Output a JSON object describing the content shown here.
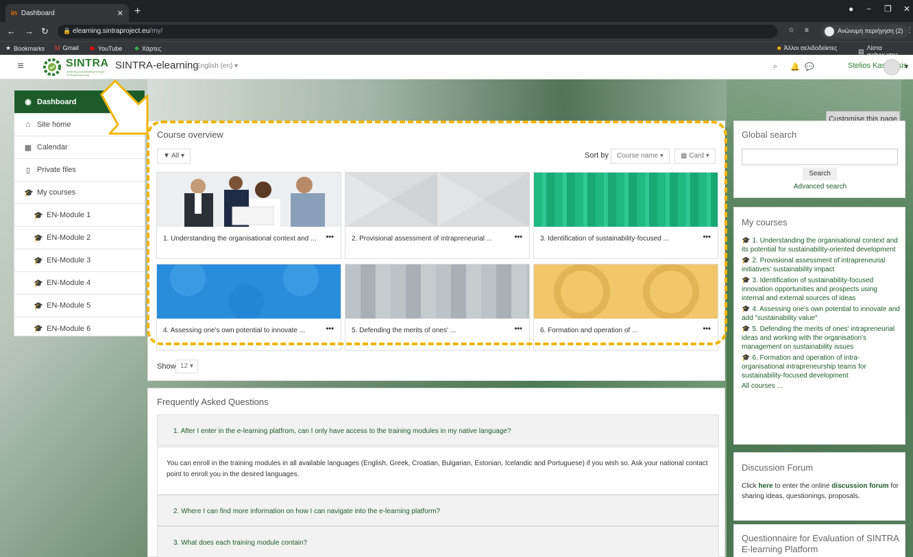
{
  "browser": {
    "tab_title": "Dashboard",
    "tab_favicon": "in",
    "url_domain": "elearning.sintraproject.eu",
    "url_path": "/my/",
    "profile_label": "Ανώνυμη περιήγηση (2)",
    "bookmarks": [
      "Bookmarks",
      "Gmail",
      "YouTube",
      "Χάρτες"
    ],
    "bookmarks_right": [
      "Άλλοι σελιδοδείκτες",
      "Λίστα ανάγνωσης"
    ]
  },
  "header": {
    "logo_text": "SINTRA",
    "logo_tagline": "achieving sustainability through INTRApreneurship",
    "site_name": "SINTRA-elearning",
    "language": "English (en)",
    "username": "Stelios Kasznesis"
  },
  "nav": {
    "items": [
      {
        "label": "Dashboard",
        "icon": "dashboard-icon"
      },
      {
        "label": "Site home",
        "icon": "home-icon"
      },
      {
        "label": "Calendar",
        "icon": "calendar-icon"
      },
      {
        "label": "Private files",
        "icon": "file-icon"
      },
      {
        "label": "My courses",
        "icon": "graduation-cap-icon"
      },
      {
        "label": "EN-Module 1",
        "icon": "graduation-cap-icon"
      },
      {
        "label": "EN-Module 2",
        "icon": "graduation-cap-icon"
      },
      {
        "label": "EN-Module 3",
        "icon": "graduation-cap-icon"
      },
      {
        "label": "EN-Module 4",
        "icon": "graduation-cap-icon"
      },
      {
        "label": "EN-Module 5",
        "icon": "graduation-cap-icon"
      },
      {
        "label": "EN-Module 6",
        "icon": "graduation-cap-icon"
      }
    ]
  },
  "customise_label": "Customise this page",
  "course_overview": {
    "title": "Course overview",
    "filter": "All",
    "sort_by_label": "Sort by",
    "sort_value": "Course name",
    "view_value": "Card",
    "show_label": "Show",
    "show_value": "12",
    "cards": [
      {
        "title": "1. Understanding the organisational context and ..."
      },
      {
        "title": "2. Provisional assessment of intrapreneurial ..."
      },
      {
        "title": "3. Identification of sustainability-focused ..."
      },
      {
        "title": "4. Assessing one's own potential to innovate ..."
      },
      {
        "title": "5. Defending the merits of ones' ..."
      },
      {
        "title": "6. Formation and operation of ..."
      }
    ]
  },
  "faq": {
    "title": "Frequently Asked Questions",
    "q1": "1. After I enter in the e-learning platfrom, can I only have access to the training modules in my native language?",
    "a1": "You can enroll in the training modules in all available languages (English, Greek, Croatian, Bulgarian, Estonian, Icelandic and Portuguese) if you wish so. Ask your national contact point to enroll you in the desired languages.",
    "q2": "2. Where I can find more information on how I can navigate into the e-learning platform?",
    "q3": "3. What does each training module contain?"
  },
  "global_search": {
    "title": "Global search",
    "button": "Search",
    "advanced": "Advanced search"
  },
  "my_courses": {
    "title": "My courses",
    "items": [
      "1. Understanding the organisational context and its potential for sustainability-oriented development",
      "2. Provisional assessment of intrapreneurial initiatives' sustainability impact",
      "3. Identification of sustainability-focused innovation opportunities and prospects using internal and external sources of ideas",
      "4. Assessing one's own potential to innovate and add \"sustainability value\"",
      "5. Defending the merits of ones' intrapreneurial ideas and working with the organisation's management on sustainability issues",
      "6. Formation and operation of intra-organisational intrapreneurship teams for sustainability-focused development"
    ],
    "all_courses": "All courses ..."
  },
  "discussion": {
    "title": "Discussion Forum",
    "pre": "Click ",
    "here": "here",
    "mid": " to enter the online ",
    "forum": "discussion forum",
    "post": " for sharing ideas, questionings, proposals."
  },
  "questionnaire": {
    "title": "Questionnaire for Evaluation of SINTRA E-learning Platform"
  },
  "colors": {
    "brand_green": "#1d5c2a",
    "link_green": "#2e7d32",
    "highlight_yellow": "#f0b400"
  }
}
